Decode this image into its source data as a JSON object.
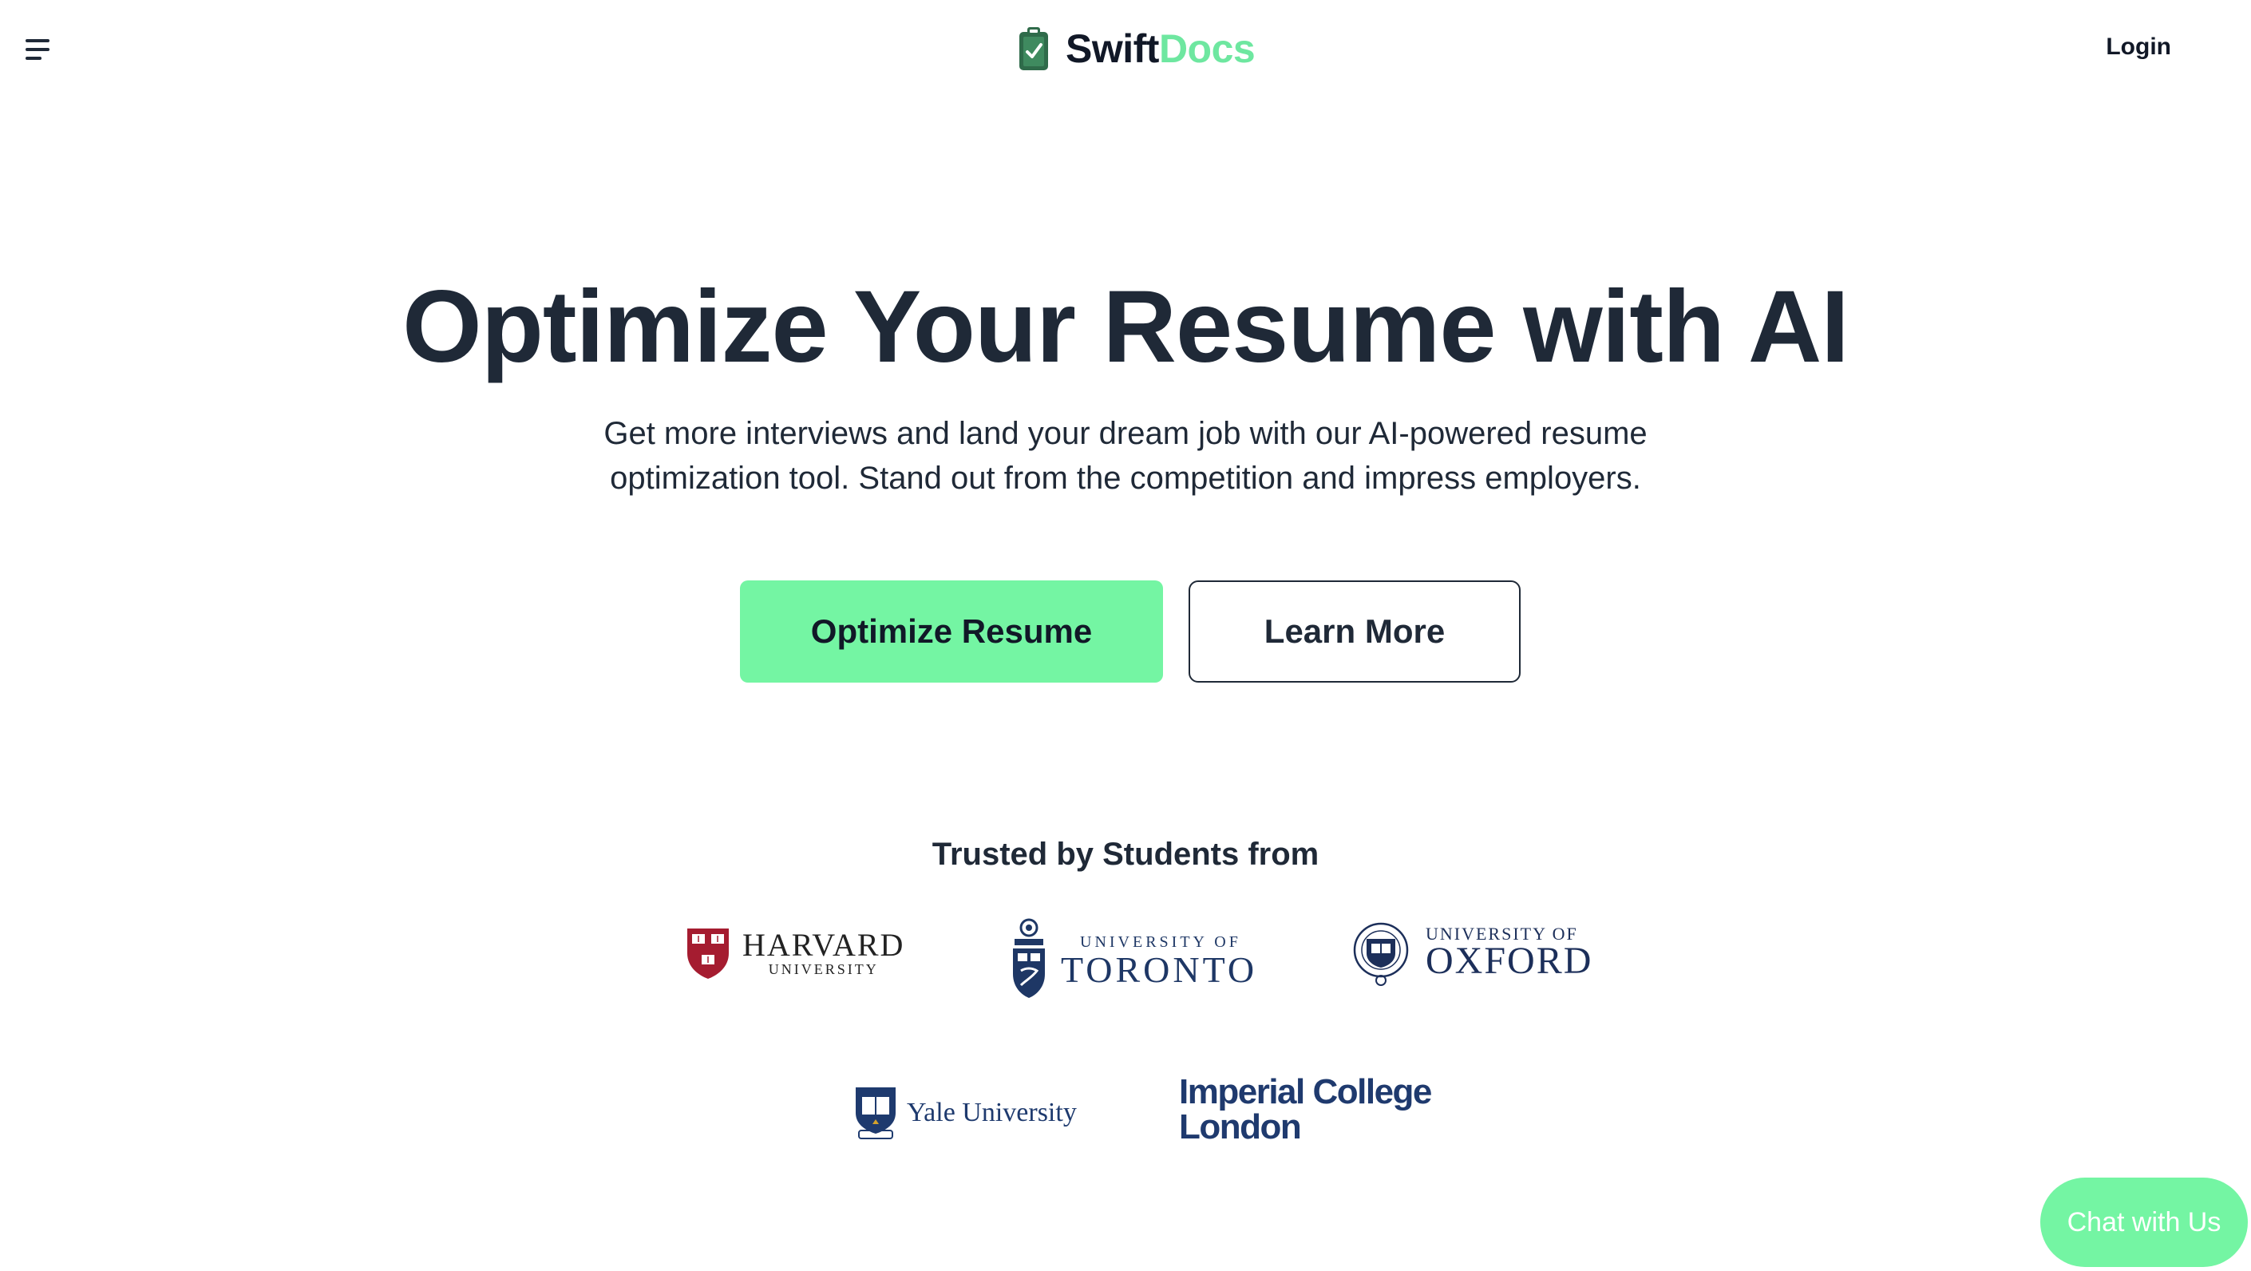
{
  "header": {
    "brand_part1": "Swift",
    "brand_part2": "Docs",
    "login_label": "Login",
    "menu_icon": "hamburger-menu-icon",
    "logo_icon": "document-check-icon"
  },
  "hero": {
    "title": "Optimize Your Resume with AI",
    "subtitle": "Get more interviews and land your dream job with our AI-powered resume optimization tool. Stand out from the competition and impress employers.",
    "primary_button": "Optimize Resume",
    "secondary_button": "Learn More"
  },
  "trusted": {
    "title": "Trusted by Students from",
    "harvard": {
      "line1": "HARVARD",
      "line2": "UNIVERSITY"
    },
    "toronto": {
      "line1": "UNIVERSITY OF",
      "line2": "TORONTO"
    },
    "oxford": {
      "line1": "UNIVERSITY OF",
      "line2": "OXFORD"
    },
    "yale": {
      "name": "Yale University"
    },
    "imperial": {
      "line1": "Imperial College",
      "line2": "London"
    }
  },
  "chat": {
    "label": "Chat with Us"
  },
  "colors": {
    "accent": "#74f5a3",
    "brand_green": "#6ee7a0",
    "text_dark": "#1f2937"
  }
}
